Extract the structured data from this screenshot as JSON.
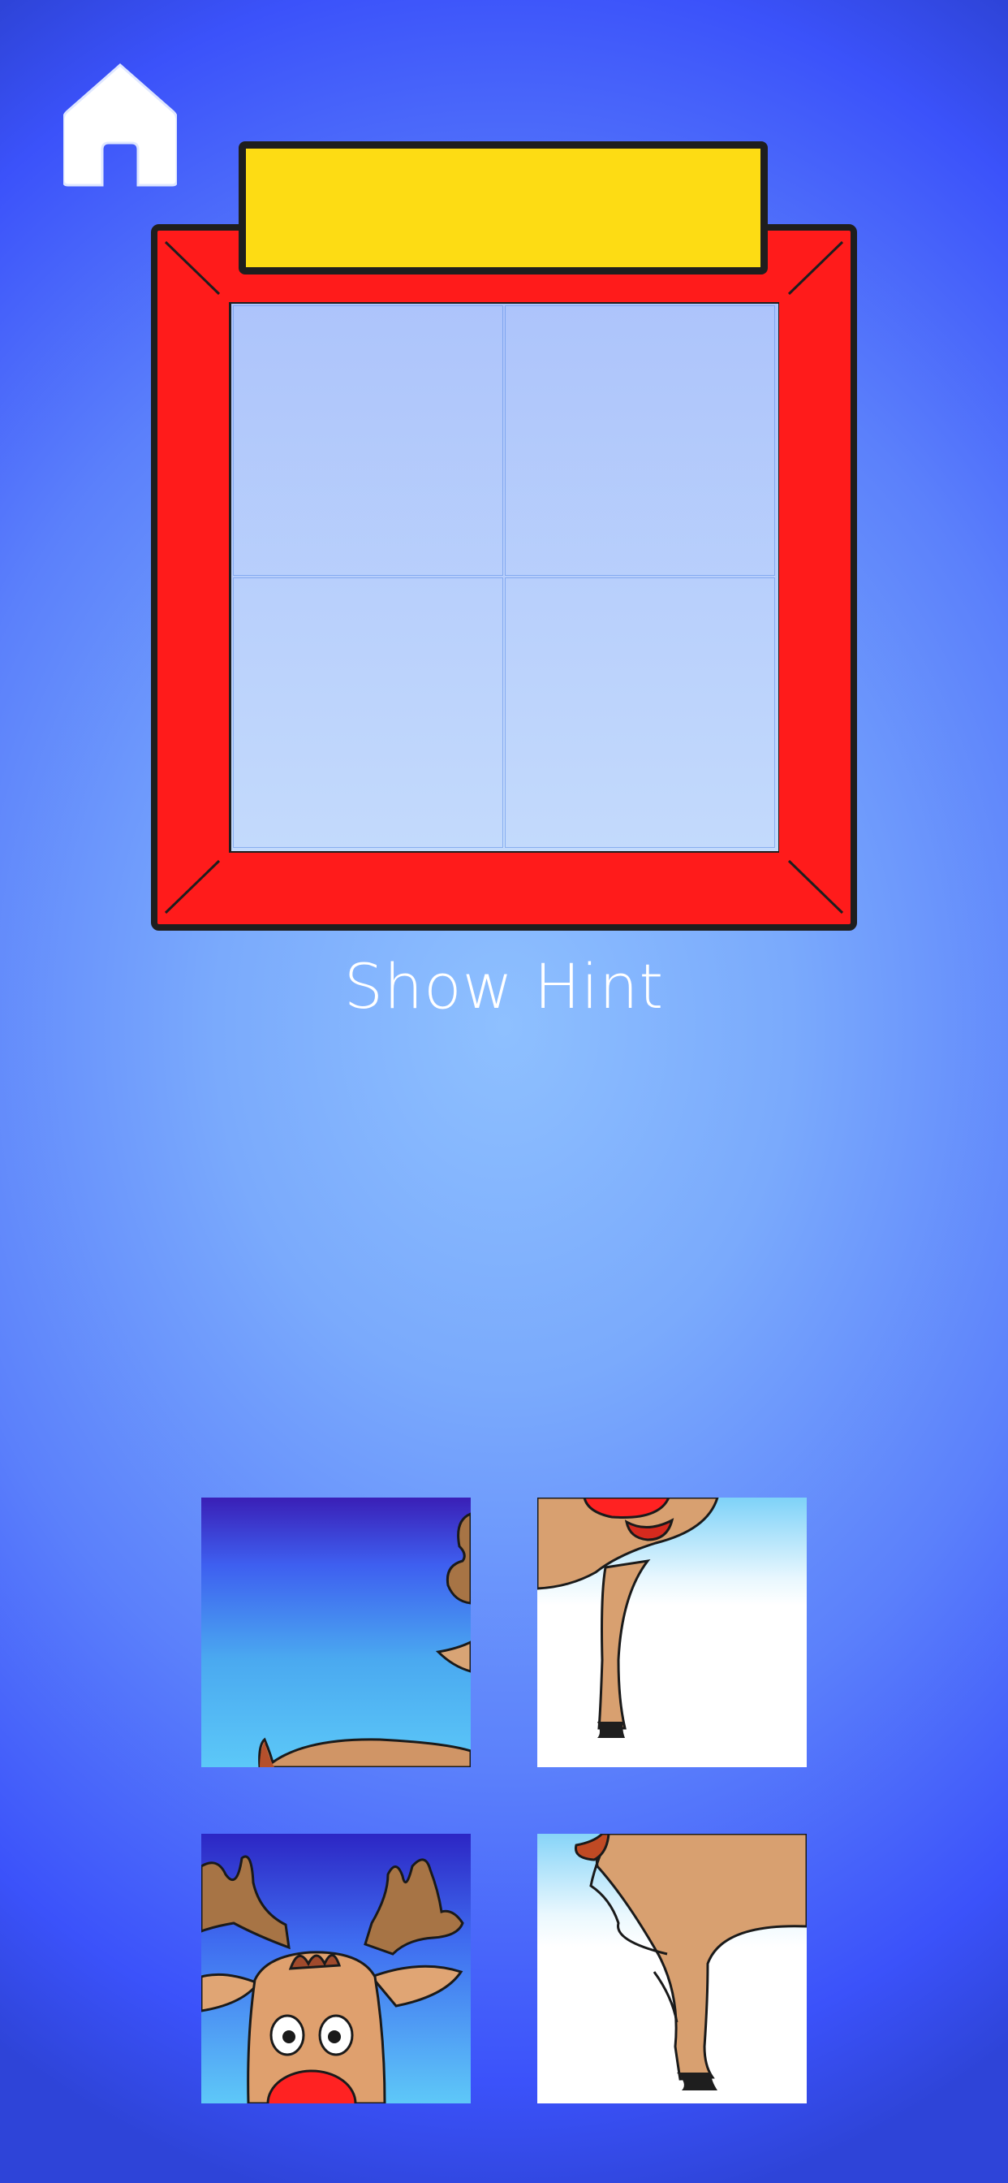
{
  "nav": {
    "home_icon": "home-icon"
  },
  "puzzle": {
    "frame_color": "#ff1b1b",
    "plate_color": "#fddc14",
    "board_color": "#b7cdfb",
    "grid": {
      "rows": 2,
      "cols": 2
    },
    "hint_label": "Show Hint"
  },
  "pieces": [
    {
      "content": "sky-and-reindeer-back"
    },
    {
      "content": "reindeer-mouth-and-leg"
    },
    {
      "content": "reindeer-face-and-antlers"
    },
    {
      "content": "reindeer-body-and-hind-leg"
    }
  ]
}
